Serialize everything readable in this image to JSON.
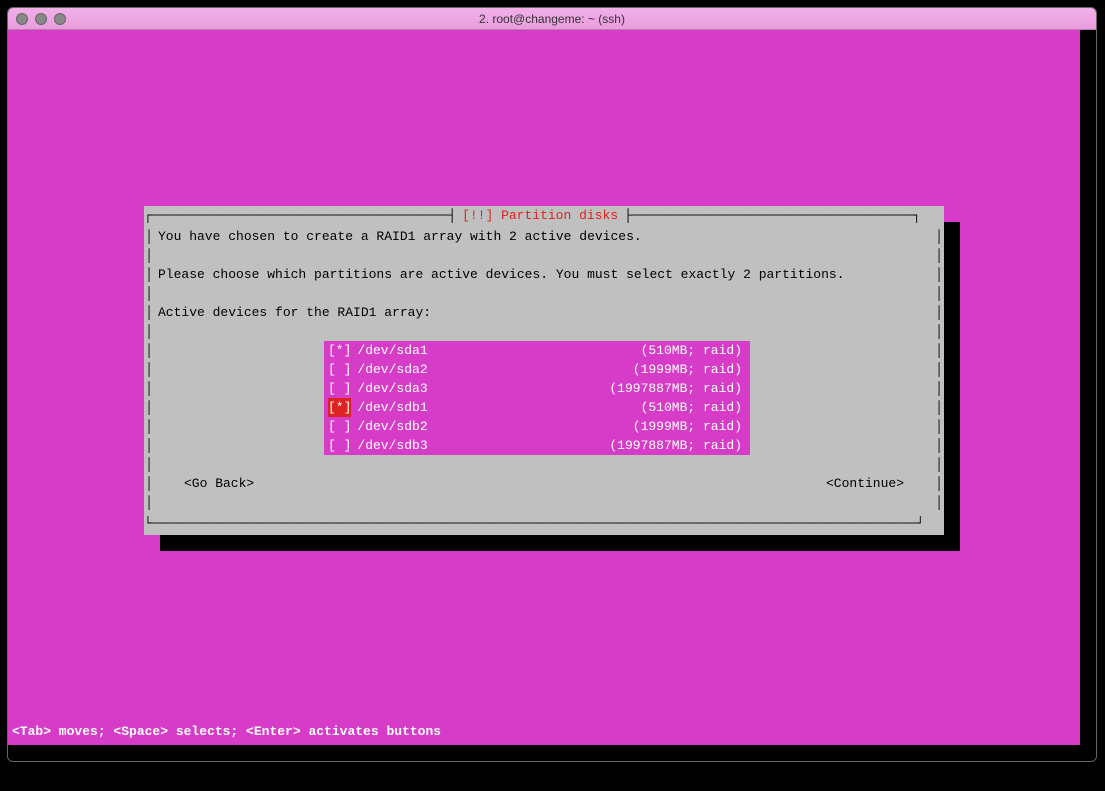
{
  "window": {
    "title": "2. root@changeme: ~ (ssh)"
  },
  "dialog": {
    "title": "[!!] Partition disks",
    "line1": "You have chosen to create a RAID1 array with 2 active devices.",
    "line2": "Please choose which partitions are active devices. You must select exactly 2 partitions.",
    "line3": "Active devices for the RAID1 array:",
    "go_back": "<Go Back>",
    "continue": "<Continue>"
  },
  "partitions": [
    {
      "checked": true,
      "cursor": false,
      "device": "/dev/sda1",
      "info": "(510MB; raid)"
    },
    {
      "checked": false,
      "cursor": false,
      "device": "/dev/sda2",
      "info": "(1999MB; raid)"
    },
    {
      "checked": false,
      "cursor": false,
      "device": "/dev/sda3",
      "info": "(1997887MB; raid)"
    },
    {
      "checked": true,
      "cursor": true,
      "device": "/dev/sdb1",
      "info": "(510MB; raid)"
    },
    {
      "checked": false,
      "cursor": false,
      "device": "/dev/sdb2",
      "info": "(1999MB; raid)"
    },
    {
      "checked": false,
      "cursor": false,
      "device": "/dev/sdb3",
      "info": "(1997887MB; raid)"
    }
  ],
  "statusbar": "<Tab> moves; <Space> selects; <Enter> activates buttons",
  "glyphs": {
    "h": "─",
    "v": "│",
    "tl": "┌",
    "tr": "┐",
    "bl": "└",
    "br": "┘",
    "teeL": "┤",
    "teeR": "├"
  }
}
